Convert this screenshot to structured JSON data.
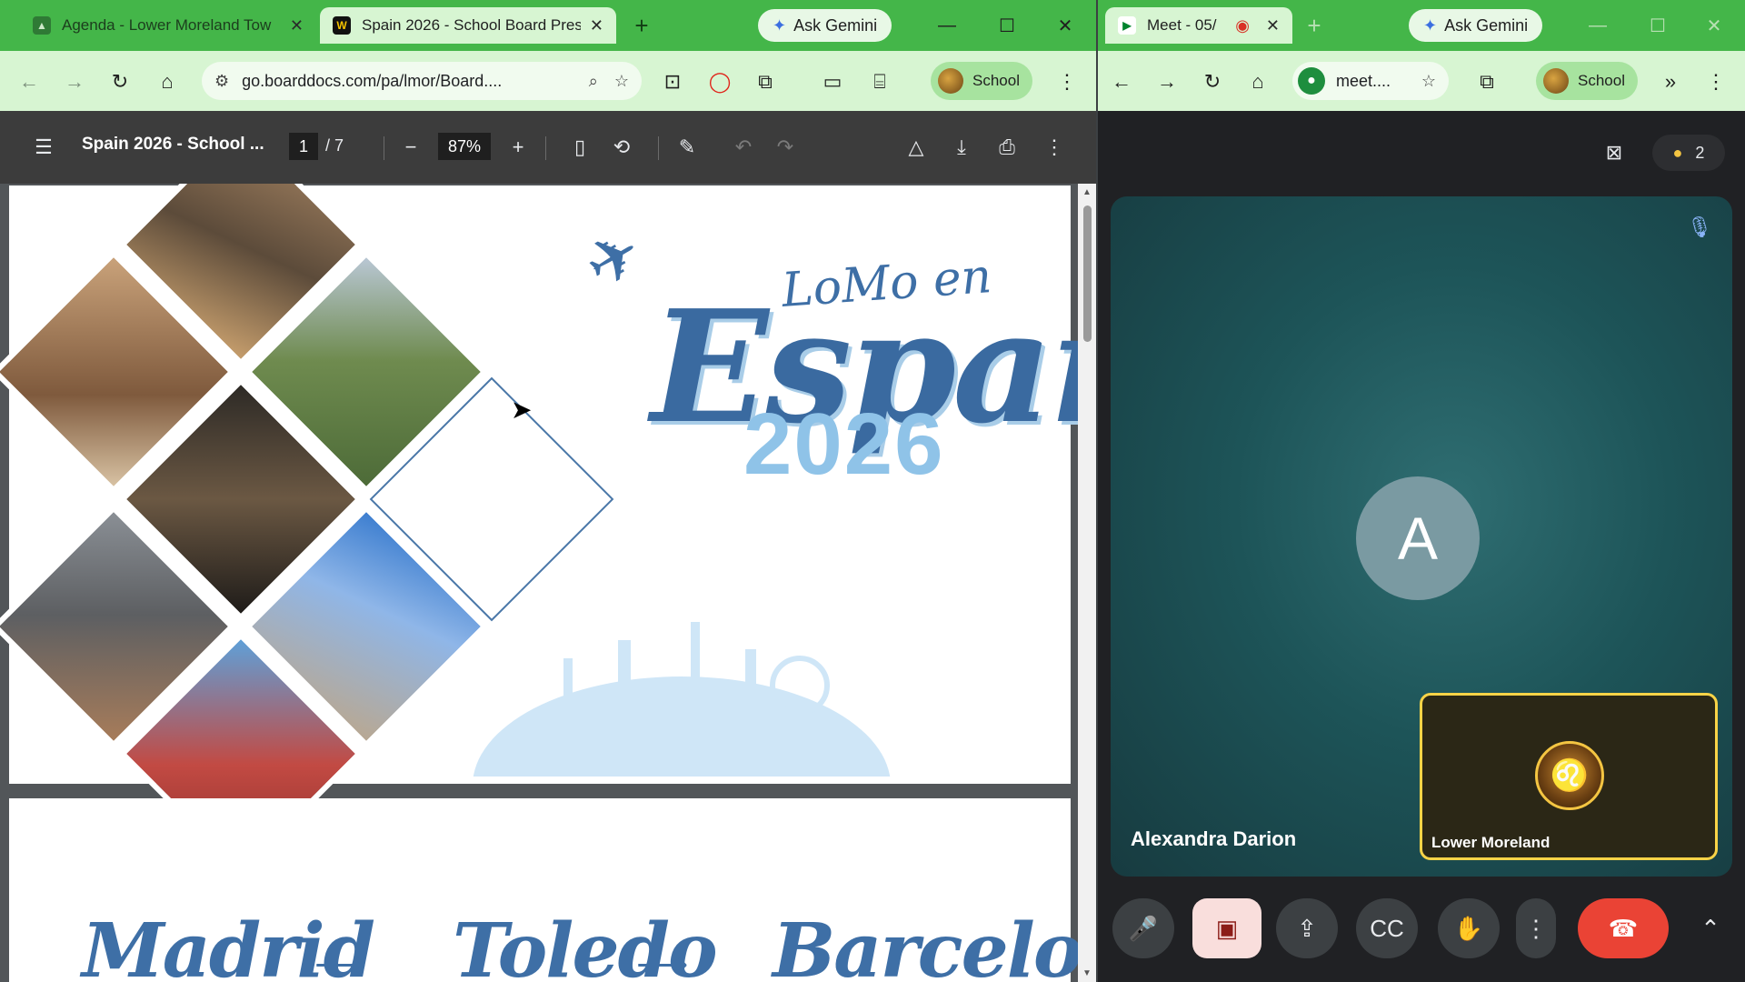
{
  "left_window": {
    "tabs": [
      {
        "label": "Agenda - Lower Moreland Tow",
        "active": false
      },
      {
        "label": "Spain 2026 - School Board Pres",
        "active": true
      }
    ],
    "new_tab": "+",
    "ask_gemini": "Ask Gemini",
    "controls": {
      "minimize": "—",
      "maximize": "☐",
      "close": "✕"
    },
    "url": "go.boarddocs.com/pa/lmor/Board....",
    "profile_label": "School",
    "pdf": {
      "title": "Spain 2026 - School ...",
      "page_current": "1",
      "page_total": "/ 7",
      "zoom": "87%"
    },
    "slide1": {
      "script_line": "LoMo en",
      "main_word": "España",
      "year": "2026"
    },
    "slide2": {
      "route": [
        "Madrid",
        "Toledo",
        "Barcelona"
      ]
    }
  },
  "right_window": {
    "tab_label": "Meet - 05/",
    "new_tab": "+",
    "ask_gemini": "Ask Gemini",
    "url": "meet....",
    "profile_label": "School",
    "participant_count": "2",
    "main_participant": {
      "initial": "A",
      "name": "Alexandra Darion"
    },
    "self_participant": {
      "name": "Lower Moreland"
    }
  },
  "colors": {
    "tab_strip": "#44b649",
    "toolbar": "#d7f5d2",
    "pdf_toolbar": "#3c3c3c",
    "accent_blue": "#3a6aa0",
    "end_call": "#ea4335",
    "self_border": "#f9d347"
  }
}
